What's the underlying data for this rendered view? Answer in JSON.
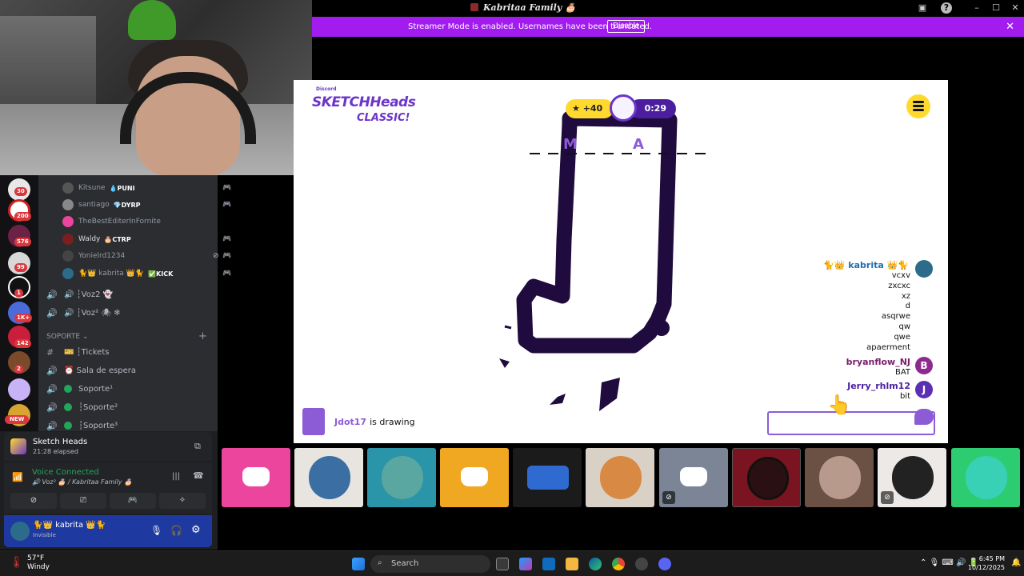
{
  "window": {
    "title": "Kabritaa Family 🎂"
  },
  "banner": {
    "message": "Streamer Mode is enabled. Usernames have been truncated.",
    "disable_label": "Disable",
    "close": "✕"
  },
  "guilds": [
    {
      "badge": "30"
    },
    {
      "badge": "200"
    },
    {
      "badge": "576"
    },
    {
      "badge": "99"
    },
    {
      "badge": "1"
    },
    {
      "badge": "1K+"
    },
    {
      "badge": "142"
    },
    {
      "badge": "2"
    },
    {
      "badge": ""
    },
    {
      "badge": "NEW"
    }
  ],
  "members": [
    {
      "name": "Kitsune",
      "tag": "💧PUNI",
      "color": "#949ba4",
      "av": "#555"
    },
    {
      "name": "santiago",
      "tag": "💎DYRP",
      "color": "#949ba4",
      "av": "#888"
    },
    {
      "name": "TheBestEditerInFornite",
      "tag": "",
      "color": "#949ba4",
      "av": "#eb459e"
    },
    {
      "name": "Waldy",
      "tag": "🎂CTRP",
      "color": "#dbdee1",
      "av": "#7a1f1f"
    },
    {
      "name": "Yonielrd1234",
      "tag": "",
      "color": "#949ba4",
      "av": "#444"
    },
    {
      "name": "🐈👑 kabrita 👑🐈",
      "tag": "✅KICK",
      "color": "#b5bac1",
      "av": "#2d6b8a"
    }
  ],
  "channels": [
    {
      "sym": "🔊",
      "name": "🔊 ┆Voz2 👻"
    },
    {
      "sym": "🔊",
      "name": "🔊 ┆Voz² 🕷 ❄"
    }
  ],
  "category": "SOPORTE ⌄",
  "support_channels": [
    {
      "sym": "#",
      "name": "🎫 ┆Tickets",
      "dot": false
    },
    {
      "sym": "🔊",
      "name": "⏰ Sala de espera",
      "dot": false
    },
    {
      "sym": "🔊",
      "name": "Soporte¹",
      "dot": true
    },
    {
      "sym": "🔊",
      "name": "┆Soporte²",
      "dot": true
    },
    {
      "sym": "🔊",
      "name": "┆Soporte³",
      "dot": true
    }
  ],
  "activity": {
    "name": "Sketch Heads",
    "elapsed": "21:28 elapsed"
  },
  "voice": {
    "status": "Voice Connected",
    "channel": "🔊 Voz² 🎂 / Kabritaa Family 🎂"
  },
  "user": {
    "name": "🐈👑 kabrita 👑🐈",
    "status": "Invisible"
  },
  "game": {
    "logo_top": "Discord",
    "logo_main": "SKETCHHeads",
    "logo_sub": "CLASSIC!",
    "points": "★ +40",
    "timer": "0:29",
    "hint_letters": [
      "M",
      "A"
    ],
    "drawer": "Jdot17",
    "drawer_suffix": "is drawing",
    "guesses": [
      {
        "user": "🐈👑 kabrita 👑🐈",
        "color": "#1f6fb0",
        "avatar": "",
        "av_color": "#2d6b8a",
        "lines": [
          "vcxv",
          "zxcxc",
          "xz",
          "d",
          "asqrwe",
          "qw",
          "qwe",
          "apaerment"
        ]
      },
      {
        "user": "bryanflow_NJ",
        "color": "#7a1c6b",
        "avatar": "B",
        "av_color": "#8e2a8e",
        "lines": [
          "BAT"
        ]
      },
      {
        "user": "Jerry_rhlm12",
        "color": "#4a1e9e",
        "avatar": "J",
        "av_color": "#5a2fb4",
        "lines": [
          "bit"
        ]
      }
    ]
  },
  "tiles": [
    {
      "bg": "#eb459e",
      "type": "discord",
      "muted": false
    },
    {
      "bg": "#e8e4e0",
      "type": "face",
      "face": "#3b6fa3",
      "muted": false
    },
    {
      "bg": "#2a94a8",
      "type": "face",
      "face": "#5aa6a0",
      "muted": false
    },
    {
      "bg": "#f0a722",
      "type": "discord",
      "muted": false
    },
    {
      "bg": "#1b1b1b",
      "type": "face",
      "face": "#2f6ad0",
      "muted": false
    },
    {
      "bg": "#d9d1c6",
      "type": "face",
      "face": "#d88a45",
      "muted": false
    },
    {
      "bg": "#7b8596",
      "type": "discord",
      "muted": true
    },
    {
      "bg": "#7a1420",
      "type": "face",
      "face": "#2a1010",
      "muted": false
    },
    {
      "bg": "#6b5144",
      "type": "face",
      "face": "#b89a8c",
      "muted": false
    },
    {
      "bg": "#ece9e6",
      "type": "face",
      "face": "#222",
      "muted": true
    },
    {
      "bg": "#2ecc71",
      "type": "face",
      "face": "#38d1b6",
      "muted": false
    }
  ],
  "taskbar": {
    "temp": "57°F",
    "weather": "Windy",
    "search": "Search",
    "time": "6:45 PM",
    "date": "10/12/2025"
  }
}
